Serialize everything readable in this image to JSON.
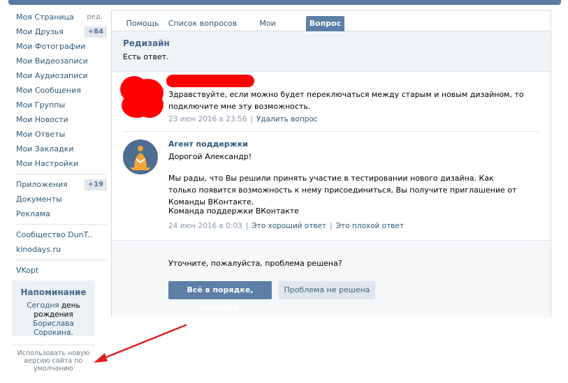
{
  "sidebar": {
    "items": [
      {
        "label": "Моя Страница",
        "extra": "ред."
      },
      {
        "label": "Мои Друзья",
        "count": "+84"
      },
      {
        "label": "Мои Фотографии"
      },
      {
        "label": "Мои Видеозаписи"
      },
      {
        "label": "Мои Аудиозаписи"
      },
      {
        "label": "Мои Сообщения"
      },
      {
        "label": "Мои Группы"
      },
      {
        "label": "Мои Новости"
      },
      {
        "label": "Мои Ответы"
      },
      {
        "label": "Мои Закладки"
      },
      {
        "label": "Мои Настройки"
      }
    ],
    "apps": [
      {
        "label": "Приложения",
        "count": "+19"
      },
      {
        "label": "Документы"
      },
      {
        "label": "Реклама"
      }
    ],
    "communities": [
      {
        "label": "Сообщество DunT.."
      },
      {
        "label": "kinodays.ru"
      }
    ],
    "extras": [
      {
        "label": "VKopt"
      }
    ],
    "reminder": {
      "title": "Напоминание",
      "text_today": "Сегодня",
      "text_day": "день",
      "text_birthday": "рождения",
      "name_first": "Борислава",
      "name_last": "Сорокина",
      "dot": "."
    },
    "new_version_text": "Использовать новую версию сайта по умолчанию"
  },
  "tabs": [
    {
      "label": "Помощь",
      "active": false
    },
    {
      "label": "Список вопросов",
      "active": false
    },
    {
      "label": "Мои вопросы",
      "active": false
    },
    {
      "label": "Вопрос",
      "active": true
    }
  ],
  "question": {
    "title": "Редизайн",
    "status": "Есть ответ."
  },
  "user_message": {
    "text": "Здравствуйте, если можно будет переключаться между старым и новым дизайном, то подключите мне эту возможность.",
    "date": "23 июн 2016 в 23:56",
    "delete_label": "Удалить вопрос"
  },
  "agent_message": {
    "author": "Агент поддержки",
    "greeting": "Дорогой Александр!",
    "body": "Мы рады, что Вы решили принять участие в тестировании нового дизайна. Как только появится возможность к нему присоединиться, Вы получите приглашение от Команды ВКонтакте.",
    "signature": "Команда поддержки ВКонтакте",
    "date": "24 июн 2016 в 0:03",
    "good_label": "Это хороший ответ",
    "bad_label": "Это плохой ответ"
  },
  "confirm": {
    "question": "Уточните, пожалуйста, проблема решена?",
    "ok_label": "Всё в порядке, спасибо",
    "no_label": "Проблема не решена"
  },
  "colors": {
    "brand": "#597da3",
    "link": "#2b587a",
    "redaction": "#ff0000",
    "annotation_arrow": "#e02020"
  }
}
